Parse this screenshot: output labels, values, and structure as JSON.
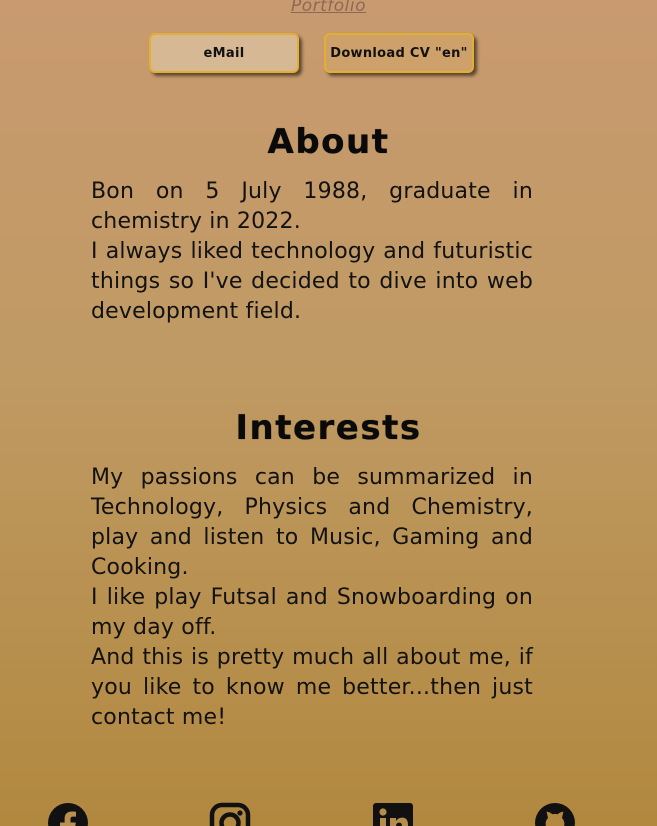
{
  "header": {
    "portfolio_link": "Portfolio"
  },
  "buttons": {
    "email_label": "eMail",
    "cv_label": "Download CV \"en\""
  },
  "about": {
    "title": "About",
    "paragraphs": [
      "Bon on 5 July 1988, graduate in chemistry in 2022.",
      "I always liked technology and futuristic things so I've decided to dive into web development field."
    ]
  },
  "interests": {
    "title": "Interests",
    "paragraphs": [
      "My passions can be summarized in Technology, Physics and Chemistry, play and listen to Music, Gaming and Cooking.",
      "I like play Futsal and Snowboarding on my day off.",
      "And this is pretty much all about me, if you like to know me better...then just contact me!"
    ]
  },
  "social": {
    "icons": [
      "facebook-icon",
      "instagram-icon",
      "linkedin-icon",
      "github-icon"
    ]
  },
  "colors": {
    "button_border": "#e0b02e",
    "email_button_bg": "#d6b894",
    "cv_button_bg": "#cea06a",
    "link_color": "#8a6a57",
    "text": "#111111"
  }
}
